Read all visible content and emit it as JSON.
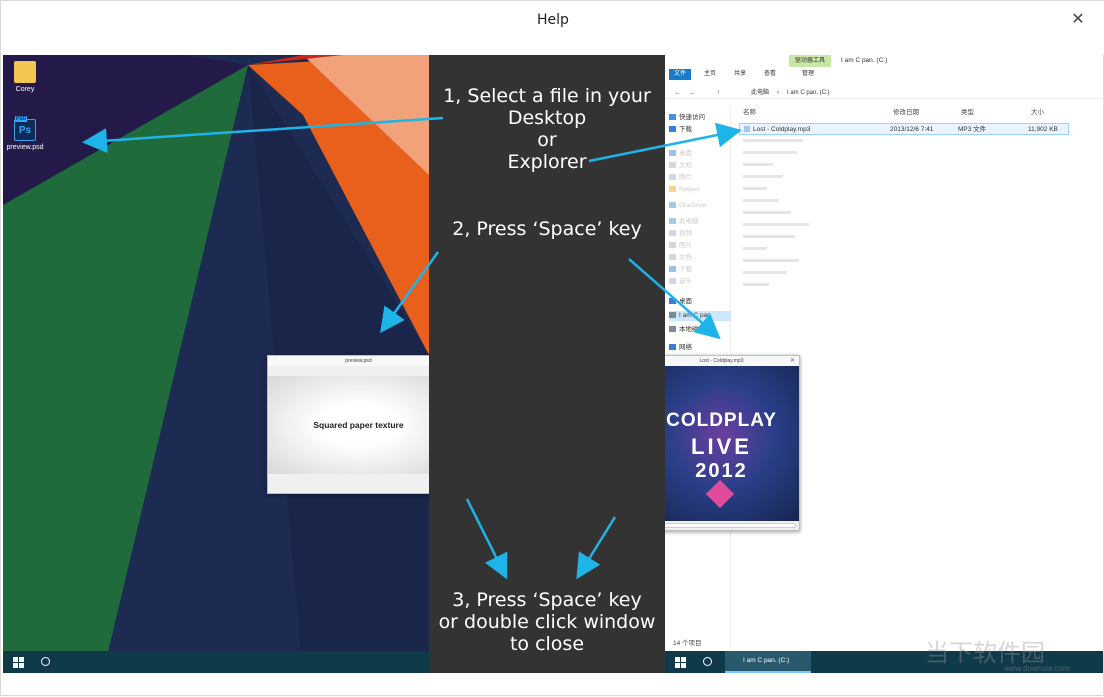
{
  "window": {
    "title": "Help",
    "close_glyph": "✕"
  },
  "desktop": {
    "icons": [
      {
        "label": "Corey",
        "icon": "user-folder-icon"
      },
      {
        "label": "preview.psd",
        "icon": "photoshop-file-icon",
        "badge": "PSD",
        "glyph_text": "Ps"
      }
    ],
    "psd_preview": {
      "title": "preview.psd",
      "content": "Squared paper texture",
      "close_glyph": "✕"
    },
    "colors": {
      "green": "#1f6b3b",
      "navy": "#1d2a52",
      "orange": "#e8601c",
      "pale_orange": "#f1a27a",
      "red": "#c4291e"
    }
  },
  "instructions": {
    "step1_lines": [
      "1, Select a file in your",
      "Desktop",
      "or",
      "Explorer"
    ],
    "step2": "2, Press ‘Space’ key",
    "step3_lines": [
      "3, Press ‘Space’ key",
      "or double click window",
      "to close"
    ]
  },
  "explorer": {
    "context_tab": "驱动器工具",
    "window_title": "I am C pan. (C:)",
    "tabs": [
      "文件",
      "主页",
      "共享",
      "查看",
      "管理"
    ],
    "address": {
      "this_pc": "此电脑",
      "separator": "›",
      "location": "I am C pan. (C:)"
    },
    "nav_items": [
      "快速访问",
      "下载",
      "",
      "桌面",
      "文档",
      "图片",
      "Netjeer",
      "OneDrive",
      "此电脑",
      "视频",
      "图片",
      "文档",
      "下载",
      "音乐",
      "桌面",
      "I am C pan",
      "本地磁盘",
      "网络"
    ],
    "columns": [
      "名称",
      "修改日期",
      "类型",
      "大小"
    ],
    "rows": [
      {
        "name": "Lost - Coldplay.mp3",
        "date": "2013/12/6 7:41",
        "type": "MP3 文件",
        "size": "11,902 KB",
        "selected": true
      }
    ],
    "status": "14 个项目",
    "taskbar_app": "I am C pan. (C:)",
    "mp3_preview": {
      "title": "Lost - Coldplay.mp3",
      "cover_band": "COLDPLAY",
      "cover_word": "LIVE",
      "cover_year": "2012"
    }
  },
  "watermark": {
    "brand": "当下软件园",
    "url": "www.downxia.com"
  }
}
